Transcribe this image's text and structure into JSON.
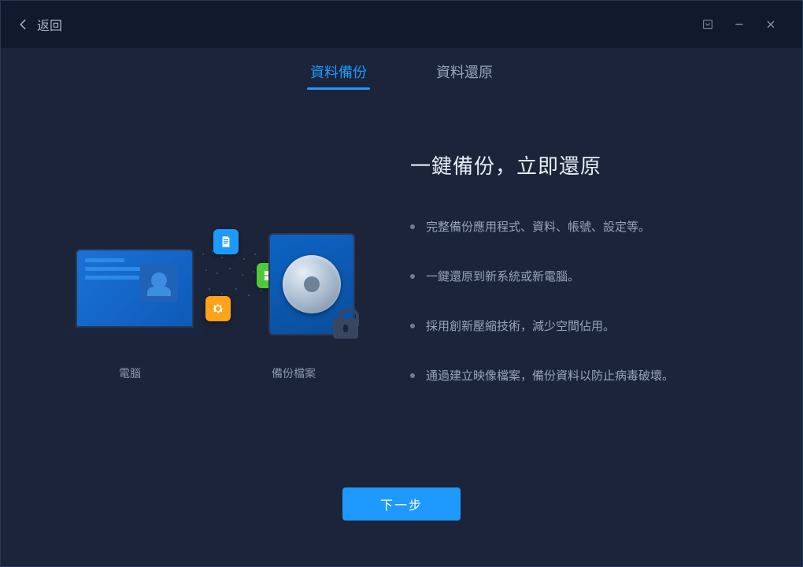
{
  "titlebar": {
    "back_label": "返回"
  },
  "tabs": {
    "backup": "資料備份",
    "restore": "資料還原",
    "active": "backup"
  },
  "headline": "一鍵備份，立即還原",
  "bullets": [
    "完整備份應用程式、資料、帳號、設定等。",
    "一鍵還原到新系統或新電腦。",
    "採用創新壓縮技術，減少空間佔用。",
    "通過建立映像檔案，備份資料以防止病毒破壞。"
  ],
  "illustration": {
    "left_label": "電腦",
    "right_label": "備份檔案"
  },
  "footer": {
    "next_label": "下一步"
  },
  "colors": {
    "accent": "#1e9aff",
    "bg": "#1b2438",
    "titlebar": "#111a2c"
  }
}
